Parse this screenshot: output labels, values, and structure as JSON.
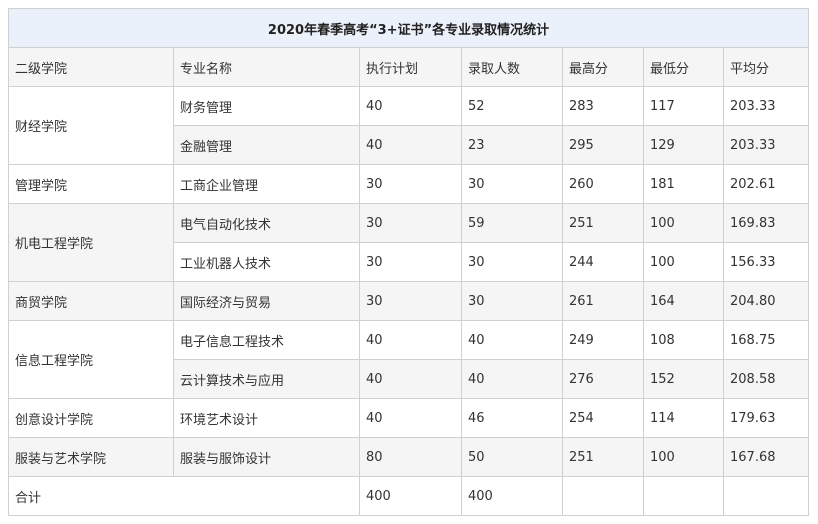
{
  "title": "2020年春季高考“3+证书”各专业录取情况统计",
  "headers": [
    "二级学院",
    "专业名称",
    "执行计划",
    "录取人数",
    "最高分",
    "最低分",
    "平均分"
  ],
  "groups": [
    {
      "college": "财经学院",
      "rows": [
        {
          "major": "财务管理",
          "plan": "40",
          "admitted": "52",
          "max": "283",
          "min": "117",
          "avg": "203.33"
        },
        {
          "major": "金融管理",
          "plan": "40",
          "admitted": "23",
          "max": "295",
          "min": "129",
          "avg": "203.33"
        }
      ]
    },
    {
      "college": "管理学院",
      "rows": [
        {
          "major": "工商企业管理",
          "plan": "30",
          "admitted": "30",
          "max": "260",
          "min": "181",
          "avg": "202.61"
        }
      ]
    },
    {
      "college": "机电工程学院",
      "rows": [
        {
          "major": "电气自动化技术",
          "plan": "30",
          "admitted": "59",
          "max": "251",
          "min": "100",
          "avg": "169.83"
        },
        {
          "major": "工业机器人技术",
          "plan": "30",
          "admitted": "30",
          "max": "244",
          "min": "100",
          "avg": "156.33"
        }
      ]
    },
    {
      "college": "商贸学院",
      "rows": [
        {
          "major": "国际经济与贸易",
          "plan": "30",
          "admitted": "30",
          "max": "261",
          "min": "164",
          "avg": "204.80"
        }
      ]
    },
    {
      "college": "信息工程学院",
      "rows": [
        {
          "major": "电子信息工程技术",
          "plan": "40",
          "admitted": "40",
          "max": "249",
          "min": "108",
          "avg": "168.75"
        },
        {
          "major": "云计算技术与应用",
          "plan": "40",
          "admitted": "40",
          "max": "276",
          "min": "152",
          "avg": "208.58"
        }
      ]
    },
    {
      "college": "创意设计学院",
      "rows": [
        {
          "major": "环境艺术设计",
          "plan": "40",
          "admitted": "46",
          "max": "254",
          "min": "114",
          "avg": "179.63"
        }
      ]
    },
    {
      "college": "服装与艺术学院",
      "rows": [
        {
          "major": "服装与服饰设计",
          "plan": "80",
          "admitted": "50",
          "max": "251",
          "min": "100",
          "avg": "167.68"
        }
      ]
    }
  ],
  "total": {
    "label": "合计",
    "plan": "400",
    "admitted": "400"
  }
}
